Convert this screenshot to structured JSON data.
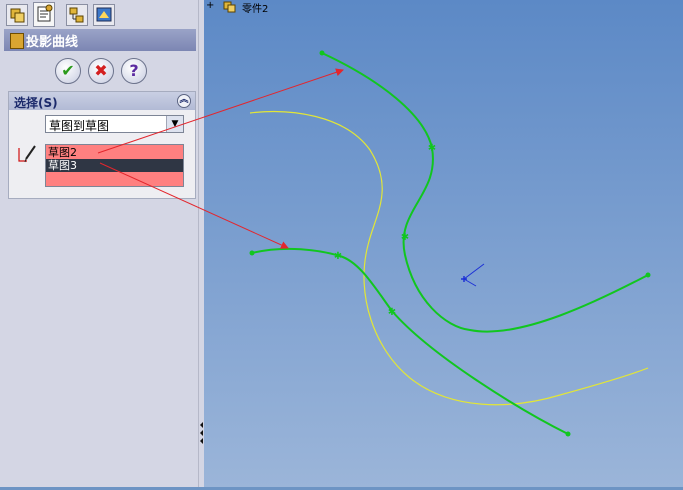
{
  "panel": {
    "title": "投影曲线",
    "group_label": "选择(S)",
    "projection_type": "草图到草图",
    "selections": [
      "草图2",
      "草图3"
    ]
  },
  "tree": {
    "expand_glyph": "+",
    "part_name": "零件2"
  },
  "buttons": {
    "ok_glyph": "✔",
    "cancel_glyph": "✖",
    "help_glyph": "?"
  },
  "colors": {
    "selection_highlight": "#ff8080",
    "curve_green": "#11c61f",
    "curve_yellow": "#e2e637",
    "callout_red": "#e3262d"
  },
  "icons": [
    "feature-manager-tab",
    "property-manager-tab",
    "configuration-manager-tab",
    "display-manager-tab",
    "projection-curve-icon",
    "sketch-pencil-icon",
    "triad-icon",
    "part-icon"
  ]
}
